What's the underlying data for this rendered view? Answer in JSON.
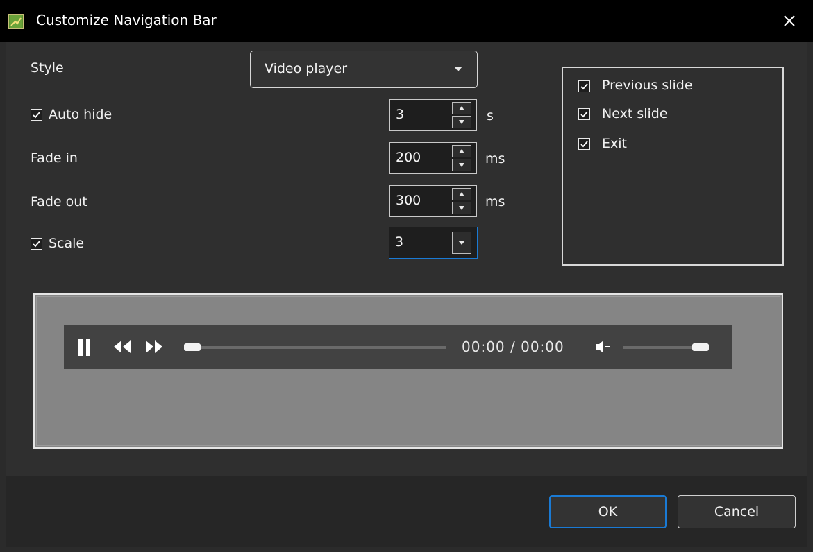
{
  "window": {
    "title": "Customize Navigation Bar",
    "close_glyph": "✕"
  },
  "form": {
    "style_label": "Style",
    "style_value": "Video player",
    "auto_hide_label": "Auto hide",
    "auto_hide_checked": true,
    "auto_hide_value": "3",
    "auto_hide_unit": "s",
    "fade_in_label": "Fade in",
    "fade_in_value": "200",
    "fade_in_unit": "ms",
    "fade_out_label": "Fade out",
    "fade_out_value": "300",
    "fade_out_unit": "ms",
    "scale_label": "Scale",
    "scale_checked": true,
    "scale_value": "3"
  },
  "buttons_list": [
    {
      "label": "Previous slide",
      "checked": true
    },
    {
      "label": "Next slide",
      "checked": true
    },
    {
      "label": "Exit",
      "checked": true
    }
  ],
  "preview": {
    "time_text": "00:00 / 00:00",
    "seek_progress": 0.0,
    "volume_level": 0.95
  },
  "footer": {
    "ok_label": "OK",
    "cancel_label": "Cancel"
  },
  "colors": {
    "accent": "#1a7ad4",
    "titlebar": "#000000",
    "background": "#2b2b2b"
  }
}
